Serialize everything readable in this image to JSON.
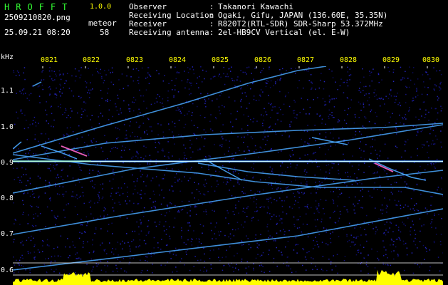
{
  "header": {
    "app_name": "HROFFT",
    "version": "1.0.0",
    "filename": "2509210820.png",
    "timestamp": "25.09.21 08:20",
    "meteor_label": "meteor",
    "meteor_count": "58"
  },
  "station": [
    {
      "key": "Observer",
      "value": "Takanori Kawachi"
    },
    {
      "key": "Receiving Location",
      "value": "Ogaki, Gifu, JAPAN (136.60E, 35.35N)"
    },
    {
      "key": "Receiver",
      "value": "R820T2(RTL-SDR) SDR-Sharp 53.372MHz"
    },
    {
      "key": "Receiving antenna",
      "value": "2el-HB9CV Vertical (el. E-W)"
    }
  ],
  "spectrogram": {
    "y_unit": "kHz",
    "y_ticks": [
      "1.1",
      "1.0",
      "0.9",
      "0.8",
      "0.7",
      "0.6"
    ],
    "x_ticks": [
      "0821",
      "0822",
      "0823",
      "0824",
      "0825",
      "0826",
      "0827",
      "0828",
      "0829",
      "0830"
    ],
    "colors": {
      "background": "#000000",
      "noise": "#10107a",
      "trail": "#4aa8ff",
      "carrier": "#c8f5ff",
      "hot": "#ff66cc",
      "level": "#ffff00",
      "grid": "#ffffff"
    }
  }
}
